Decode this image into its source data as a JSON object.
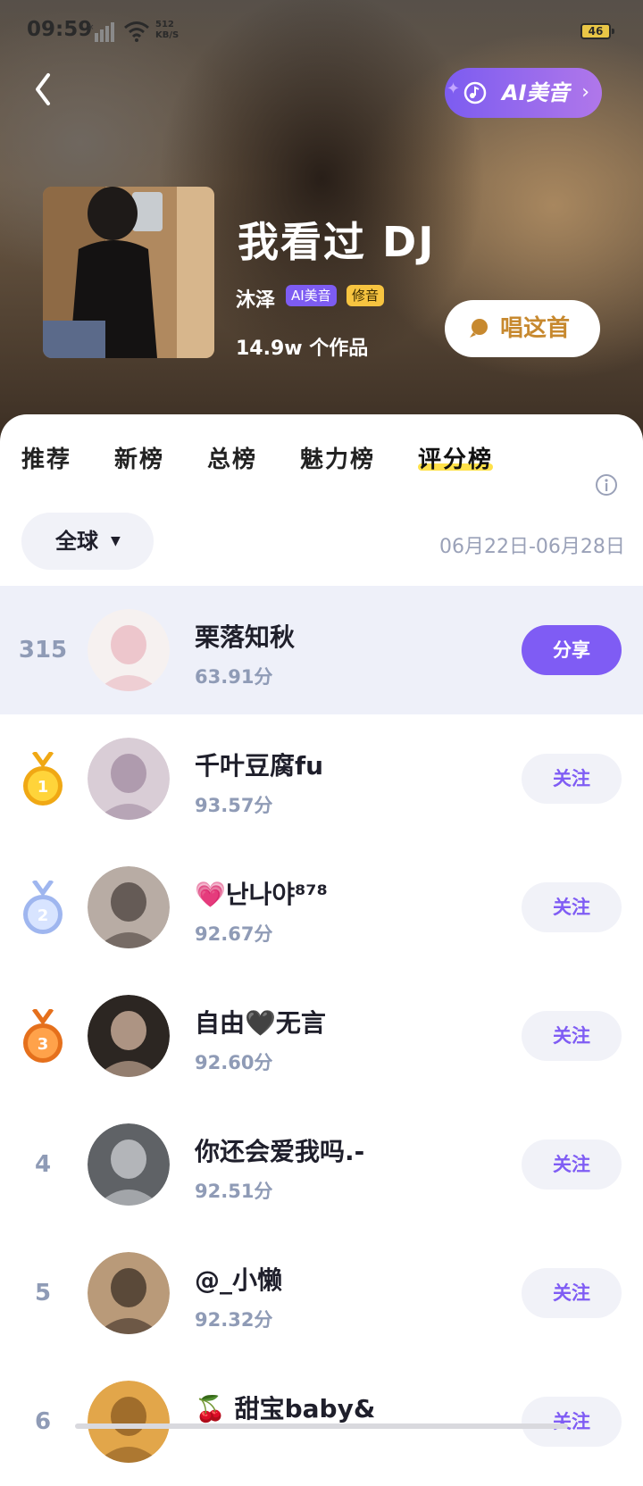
{
  "status_bar": {
    "time": "09:59",
    "net_speed_value": "512",
    "net_speed_unit": "KB/S",
    "battery": "46"
  },
  "header": {
    "ai_label": "AI美音",
    "song_title": "我看过 DJ",
    "artist": "沐泽",
    "tag_ai": "AI美音",
    "tag_fix": "修音",
    "works_count": "14.9w",
    "works_label": "个作品",
    "sing_label": "唱这首"
  },
  "tabs": [
    {
      "label": "推荐",
      "active": false
    },
    {
      "label": "新榜",
      "active": false
    },
    {
      "label": "总榜",
      "active": false
    },
    {
      "label": "魅力榜",
      "active": false
    },
    {
      "label": "评分榜",
      "active": true
    }
  ],
  "filter": {
    "region": "全球",
    "date_range": "06月22日-06月28日"
  },
  "ranking": [
    {
      "rank": "315",
      "name": "栗落知秋",
      "score": "63.91分",
      "button": "分享",
      "avatar_colors": [
        "#f6f1f0",
        "#e9b7c0"
      ]
    },
    {
      "rank": "1",
      "name": "千叶豆腐fu",
      "score": "93.57分",
      "button": "关注",
      "medal": "gold",
      "avatar_colors": [
        "#d9cdd6",
        "#a08aa0"
      ]
    },
    {
      "rank": "2",
      "name": "💗난나야⁸⁷⁸",
      "score": "92.67分",
      "button": "关注",
      "medal": "silver",
      "avatar_colors": [
        "#b8aca4",
        "#4a403c"
      ]
    },
    {
      "rank": "3",
      "name": "自由🖤无言",
      "score": "92.60分",
      "button": "关注",
      "medal": "bronze",
      "avatar_colors": [
        "#2c2622",
        "#d8b9a4"
      ]
    },
    {
      "rank": "4",
      "name": "你还会爱我吗.-",
      "score": "92.51分",
      "button": "关注",
      "avatar_colors": [
        "#5f6266",
        "#cfd2d6"
      ]
    },
    {
      "rank": "5",
      "name": "@_小懒",
      "score": "92.32分",
      "button": "关注",
      "avatar_colors": [
        "#b99a79",
        "#3b2d24"
      ]
    },
    {
      "rank": "6",
      "name": "🍒 甜宝baby&",
      "score": "",
      "button": "关注",
      "avatar_colors": [
        "#e2a64a",
        "#8a5a22"
      ]
    }
  ],
  "colors": {
    "accent": "#7f5cf4",
    "tab_highlight": "#ffe14a",
    "muted": "#8f9bb6",
    "sing_text": "#c7892f"
  }
}
